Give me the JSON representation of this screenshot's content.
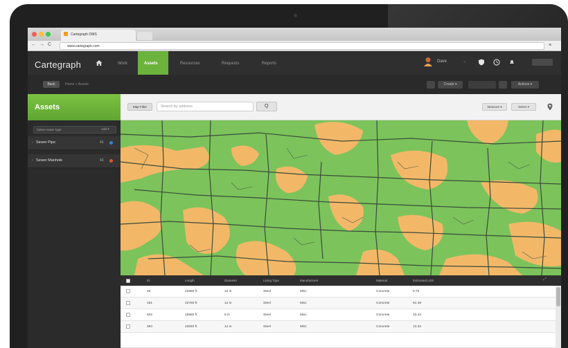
{
  "browser": {
    "tab_title": "Cartegraph OMS",
    "url": "www.cartegraph.com",
    "back_glyph": "←",
    "forward_glyph": "→",
    "reload_glyph": "C",
    "menu_glyph": "≡"
  },
  "app": {
    "logo": "Cartegraph",
    "nav": [
      "Work",
      "Assets",
      "Resources",
      "Requests",
      "Reports"
    ],
    "active_nav": "Assets",
    "user_name": "Dave",
    "colors": {
      "accent_green": "#6cb33e",
      "dark_bg": "#2f2f2f",
      "map_green": "#7cc35b",
      "map_orange": "#f2b868"
    }
  },
  "toolbar": {
    "back_label": "Back",
    "breadcrumb": "Home > Assets",
    "buttons": [
      "Create ▾",
      "Actions ▾"
    ]
  },
  "sidebar": {
    "title": "Assets",
    "asset_type_placeholder": "Select Asset Type",
    "add_label": "Add ▾",
    "layers": [
      {
        "label": "Sewer Pipe",
        "count": "41",
        "dot_color": "#3d7fd1"
      },
      {
        "label": "Sewer Manhole",
        "count": "41",
        "dot_color": "#e0532c"
      }
    ]
  },
  "search": {
    "map_filter_label": "Map Filter",
    "placeholder": "Search by address",
    "search_glyph": "Q",
    "measure_label": "Measure ▾",
    "select_label": "Select ▾"
  },
  "table": {
    "columns": [
      "ID",
      "Length",
      "Diameter",
      "Lining Type",
      "Manufacturer",
      "Material",
      "Estimated LED"
    ],
    "rows": [
      [
        "46",
        "22950 ft",
        "12 in",
        "Steel",
        "Misc",
        "Concrete",
        "9.70"
      ],
      [
        "181",
        "22750 ft",
        "12 in",
        "Steel",
        "Misc",
        "Concrete",
        "91.48"
      ],
      [
        "502",
        "18880 ft",
        "8 in",
        "Steel",
        "Misc",
        "Concrete",
        "33.43"
      ],
      [
        "394",
        "22840 ft",
        "12 in",
        "Steel",
        "Misc",
        "Concrete",
        "13.32"
      ]
    ]
  }
}
